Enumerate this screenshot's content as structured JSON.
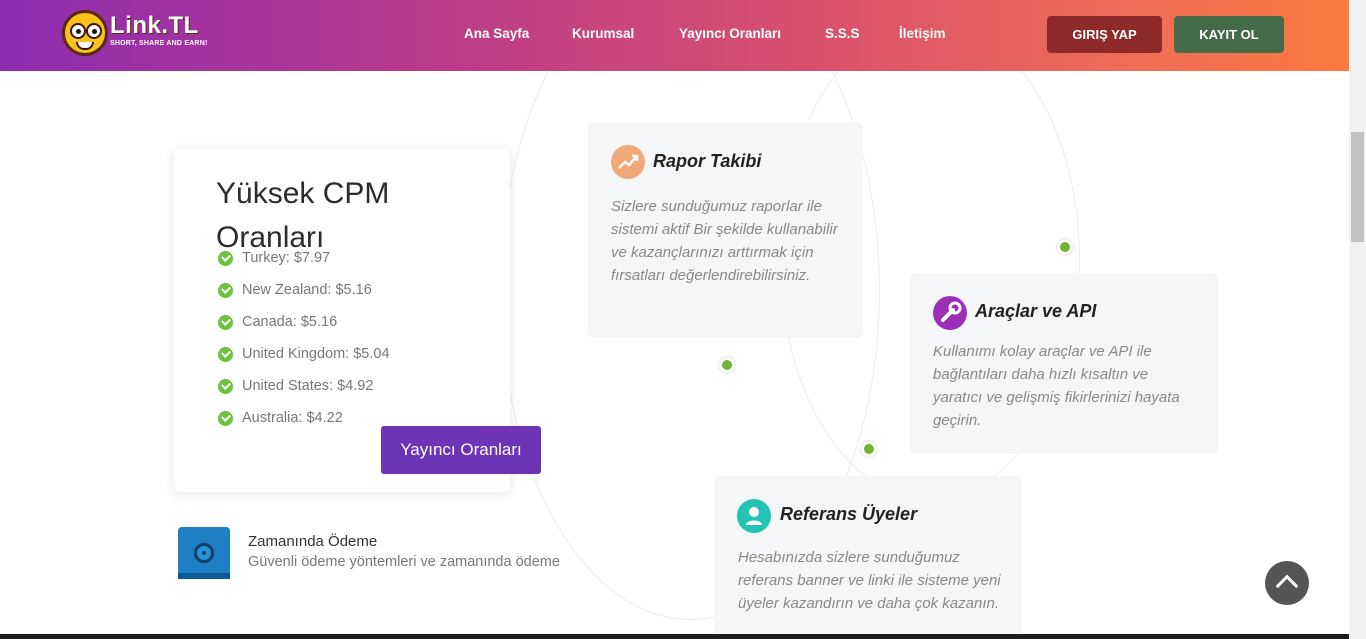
{
  "brand": {
    "name": "Link.TL",
    "tagline": "SHORT, SHARE AND EARN!"
  },
  "nav": {
    "items": [
      "Ana Sayfa",
      "Kurumsal",
      "Yayıncı Oranları",
      "S.S.S",
      "İletişim"
    ],
    "login_label": "GIRIŞ YAP",
    "register_label": "KAYIT OL"
  },
  "cpm": {
    "title": "Yüksek CPM Oranları",
    "rates": [
      "Turkey: $7.97",
      "New Zealand: $5.16",
      "Canada: $5.16",
      "United Kingdom: $5.04",
      "United States: $4.92",
      "Australia: $4.22"
    ],
    "button_label": "Yayıncı Oranları"
  },
  "payment": {
    "title": "Zamanında Ödeme",
    "description": "Güvenli ödeme yöntemleri ve zamanında ödeme"
  },
  "features": [
    {
      "title": "Rapor Takibi",
      "icon": "chart-trend-icon",
      "description": "Sizlere sunduğumuz raporlar ile sistemi aktif Bir şekilde kullanabilir ve kazançlarınızı arttırmak için fırsatları değerlendirebilirsiniz."
    },
    {
      "title": "Araçlar ve API",
      "icon": "wrench-icon",
      "description": "Kullanımı kolay araçlar ve API ile bağlantıları daha hızlı kısaltın ve yaratıcı ve gelişmiş fikirlerinizi hayata geçirin."
    },
    {
      "title": "Referans Üyeler",
      "icon": "user-icon",
      "description": "Hesabınızda sizlere sunduğumuz referans banner ve linki ile sisteme yeni üyeler kazandırın ve daha çok kazanın."
    }
  ],
  "colors": {
    "nav_gradient_start": "#8e2cb0",
    "nav_gradient_end": "#fb7a3f",
    "login_button": "#8f2a2a",
    "register_button": "#456b49",
    "cta": "#6d34b5",
    "check": "#6cc13c"
  }
}
